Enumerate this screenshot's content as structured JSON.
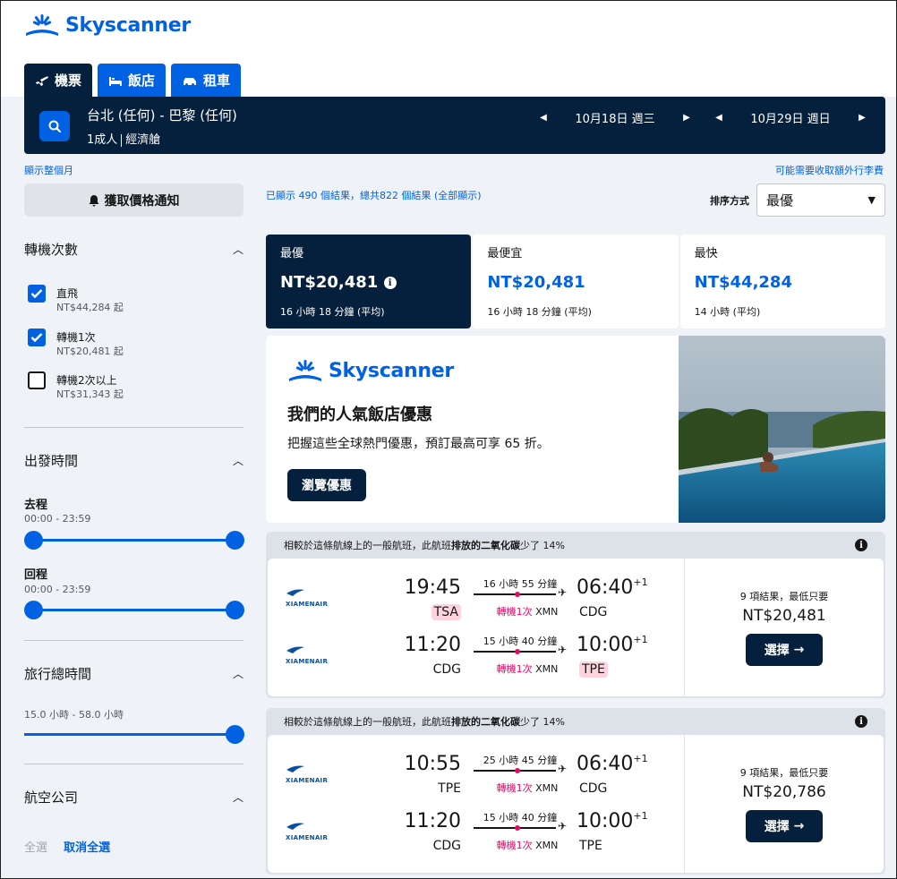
{
  "brand": {
    "name": "Skyscanner",
    "color": "#0062e3",
    "dark": "#05203c"
  },
  "tabs": [
    {
      "label": "機票",
      "icon": "plane-icon",
      "active": true
    },
    {
      "label": "飯店",
      "icon": "bed-icon",
      "active": false
    },
    {
      "label": "租車",
      "icon": "car-icon",
      "active": false
    }
  ],
  "search": {
    "route": "台北 (任何) - 巴黎 (任何)",
    "passengers": "1成人",
    "cabin": "經濟艙",
    "depart_date": "10月18日 週三",
    "return_date": "10月29日 週日"
  },
  "links": {
    "show_month": "顯示整個月",
    "baggage_fees": "可能需要收取額外行李費"
  },
  "alert_button": "獲取價格通知",
  "filters": {
    "stops": {
      "title": "轉機次數",
      "options": [
        {
          "label": "直飛",
          "price": "NT$44,284 起",
          "checked": true
        },
        {
          "label": "轉機1次",
          "price": "NT$20,481 起",
          "checked": true
        },
        {
          "label": "轉機2次以上",
          "price": "NT$31,343 起",
          "checked": false
        }
      ]
    },
    "departure_time": {
      "title": "出發時間",
      "outbound_label": "去程",
      "outbound_range": "00:00 - 23:59",
      "return_label": "回程",
      "return_range": "00:00 - 23:59"
    },
    "duration": {
      "title": "旅行總時間",
      "range": "15.0 小時 - 58.0 小時"
    },
    "airlines": {
      "title": "航空公司",
      "select_all": "全選",
      "clear_all": "取消全選"
    }
  },
  "results_info": "已顯示 490 個結果，總共822 個結果 (全部顯示)",
  "sort": {
    "label": "排序方式",
    "value": "最優"
  },
  "sort_tabs": [
    {
      "label": "最優",
      "price": "NT$20,481",
      "duration": "16 小時 18 分鐘 (平均)",
      "active": true
    },
    {
      "label": "最便宜",
      "price": "NT$20,481",
      "duration": "16 小時 18 分鐘 (平均)",
      "active": false
    },
    {
      "label": "最快",
      "price": "NT$44,284",
      "duration": "14 小時 (平均)",
      "active": false
    }
  ],
  "promo": {
    "title": "我們的人氣飯店優惠",
    "description": "把握這些全球熱門優惠，預訂最高可享 65 折。",
    "button": "瀏覽優惠"
  },
  "eco_note": {
    "prefix": "相較於這條航線上的一般航班，此航班",
    "bold": "排放的二氧化碳",
    "suffix": "少了 14%"
  },
  "flights": [
    {
      "legs": [
        {
          "airline": "XIAMENAIR",
          "dep_time": "19:45",
          "dep_airport": "TSA",
          "dep_hl": true,
          "duration": "16 小時 55 分鐘",
          "stops": "轉機1次",
          "via": "XMN",
          "arr_time": "06:40",
          "arr_day": "+1",
          "arr_airport": "CDG",
          "arr_hl": false
        },
        {
          "airline": "XIAMENAIR",
          "dep_time": "11:20",
          "dep_airport": "CDG",
          "dep_hl": false,
          "duration": "15 小時 40 分鐘",
          "stops": "轉機1次",
          "via": "XMN",
          "arr_time": "10:00",
          "arr_day": "+1",
          "arr_airport": "TPE",
          "arr_hl": true
        }
      ],
      "deals": "9 項結果，最低只要",
      "price": "NT$20,481",
      "button": "選擇"
    },
    {
      "legs": [
        {
          "airline": "XIAMENAIR",
          "dep_time": "10:55",
          "dep_airport": "TPE",
          "dep_hl": false,
          "duration": "25 小時 45 分鐘",
          "stops": "轉機1次",
          "via": "XMN",
          "arr_time": "06:40",
          "arr_day": "+1",
          "arr_airport": "CDG",
          "arr_hl": false
        },
        {
          "airline": "XIAMENAIR",
          "dep_time": "11:20",
          "dep_airport": "CDG",
          "dep_hl": false,
          "duration": "15 小時 40 分鐘",
          "stops": "轉機1次",
          "via": "XMN",
          "arr_time": "10:00",
          "arr_day": "+1",
          "arr_airport": "TPE",
          "arr_hl": false
        }
      ],
      "deals": "9 項結果，最低只要",
      "price": "NT$20,786",
      "button": "選擇"
    }
  ]
}
